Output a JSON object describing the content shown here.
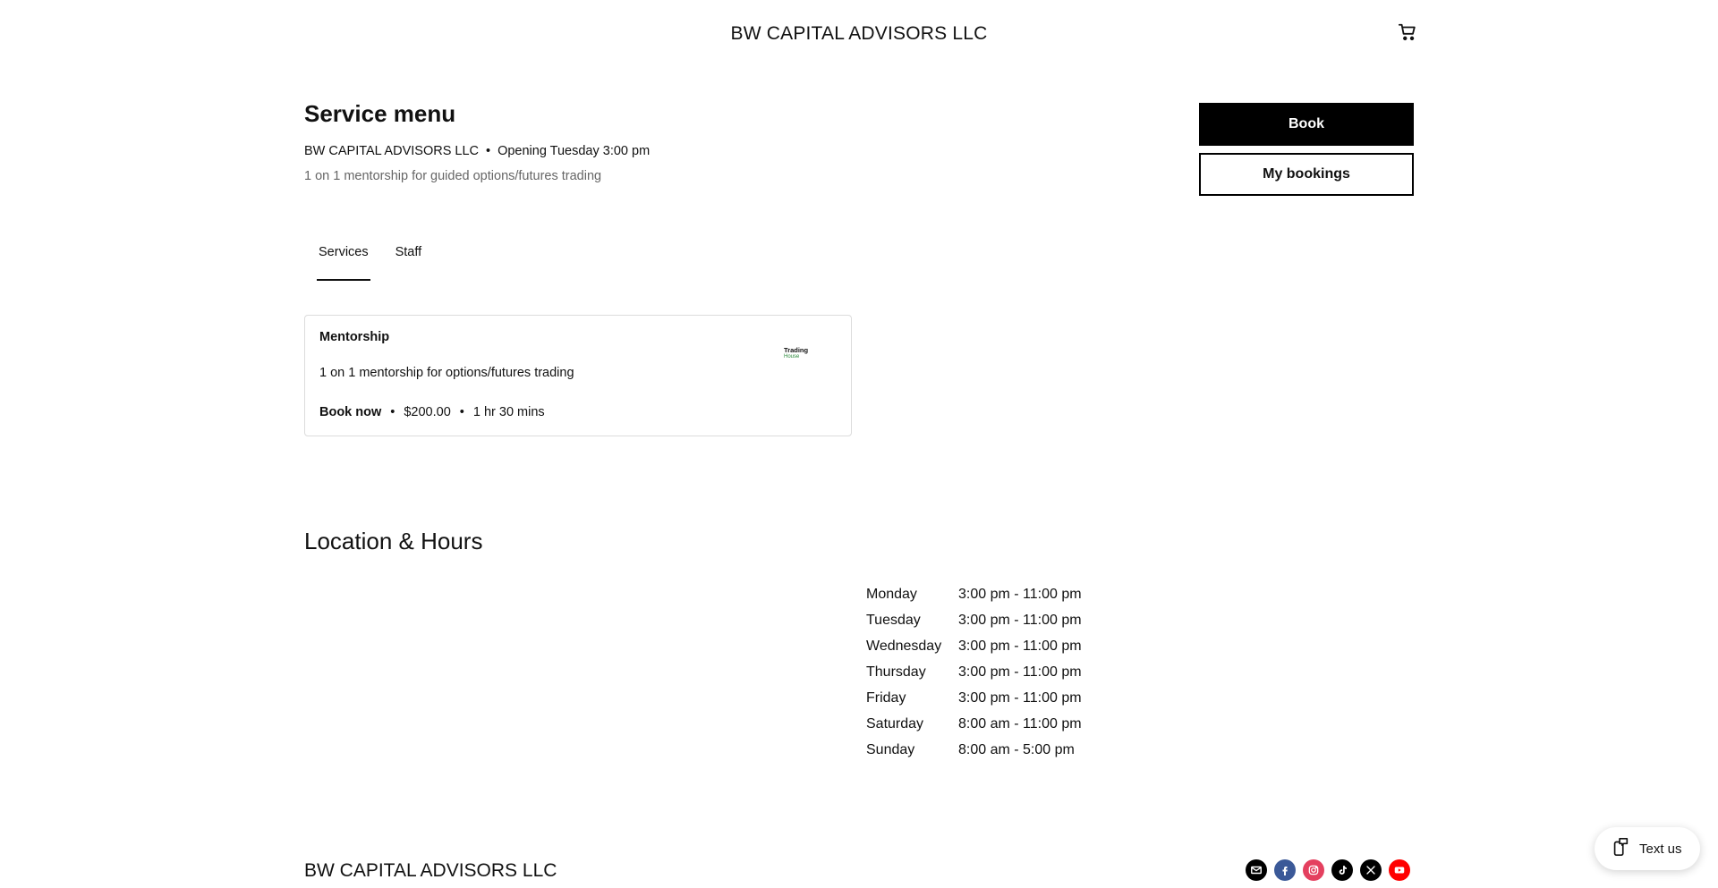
{
  "header": {
    "brand": "BW CAPITAL ADVISORS LLC",
    "cart_icon": "cart-icon"
  },
  "service_menu": {
    "title": "Service menu",
    "business_name": "BW CAPITAL ADVISORS LLC",
    "separator": "•",
    "opening": "Opening Tuesday 3:00 pm",
    "description": "1 on 1 mentorship for guided options/futures trading"
  },
  "actions": {
    "book_label": "Book",
    "my_bookings_label": "My bookings"
  },
  "tabs": [
    {
      "label": "Services",
      "active": true
    },
    {
      "label": "Staff",
      "active": false
    }
  ],
  "services": [
    {
      "name": "Mentorship",
      "description": "1 on 1 mentorship for options/futures trading",
      "book_label": "Book now",
      "separator": "•",
      "price": "$200.00",
      "duration": "1 hr 30 mins",
      "logo_line1": "Trading",
      "logo_line2": "House"
    }
  ],
  "location": {
    "title": "Location & Hours",
    "hours": [
      {
        "day": "Monday",
        "time": "3:00 pm - 11:00 pm"
      },
      {
        "day": "Tuesday",
        "time": "3:00 pm - 11:00 pm"
      },
      {
        "day": "Wednesday",
        "time": "3:00 pm - 11:00 pm"
      },
      {
        "day": "Thursday",
        "time": "3:00 pm - 11:00 pm"
      },
      {
        "day": "Friday",
        "time": "3:00 pm - 11:00 pm"
      },
      {
        "day": "Saturday",
        "time": "8:00 am - 11:00 pm"
      },
      {
        "day": "Sunday",
        "time": "8:00 am - 5:00 pm"
      }
    ]
  },
  "footer": {
    "brand": "BW CAPITAL ADVISORS LLC",
    "social_icons": [
      "email-icon",
      "facebook-icon",
      "instagram-icon",
      "tiktok-icon",
      "x-icon",
      "youtube-icon"
    ],
    "social_colors": {
      "email": "#000000",
      "facebook": "#3b5998",
      "instagram": "#e4405f",
      "tiktok": "#000000",
      "x": "#000000",
      "youtube": "#ff0000"
    }
  },
  "chat": {
    "label": "Text us",
    "icon": "chat-phone-icon"
  }
}
